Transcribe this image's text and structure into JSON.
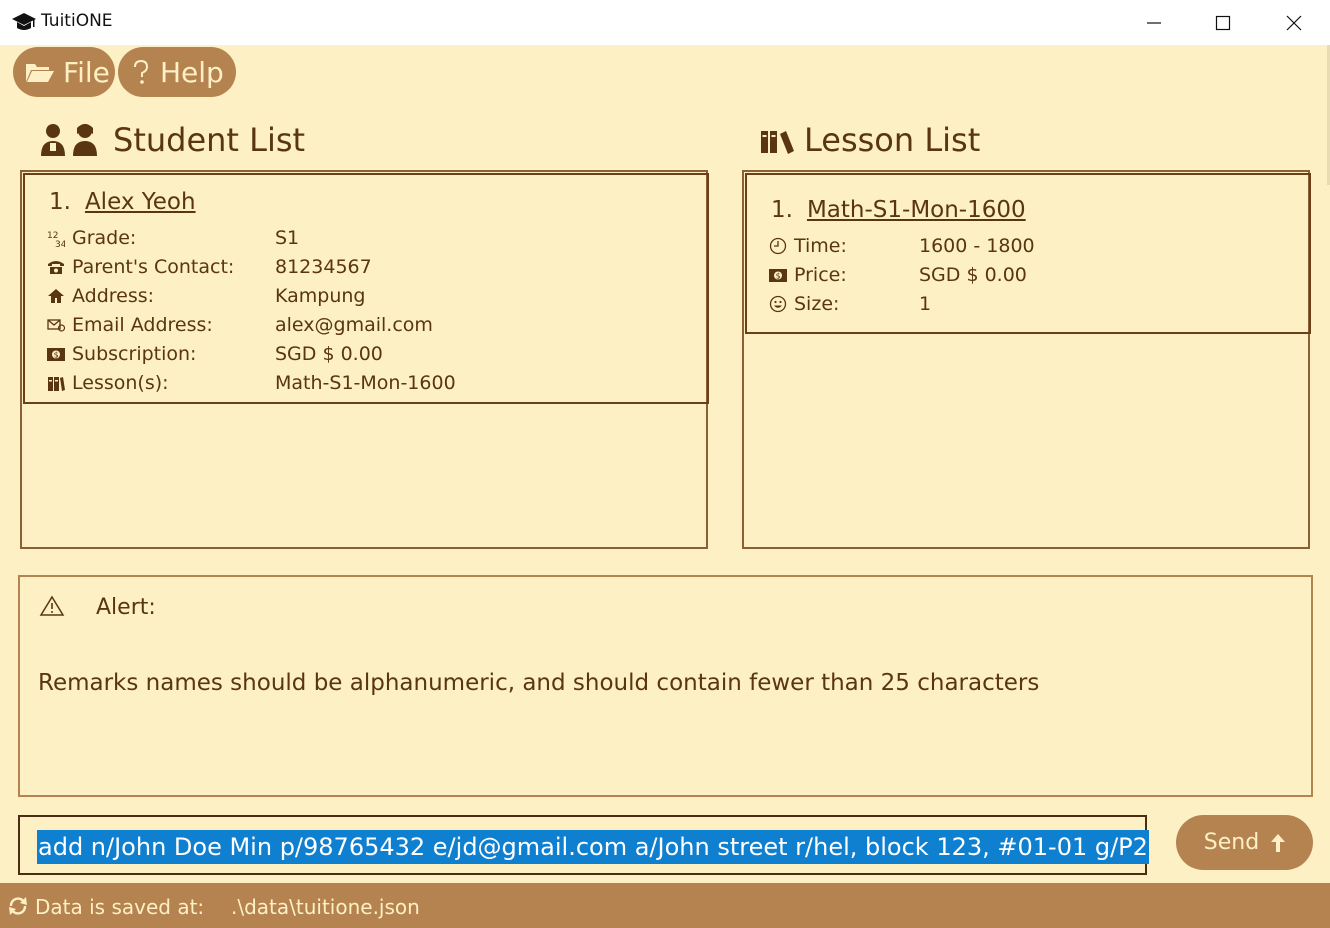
{
  "window": {
    "title": "TuitiONE"
  },
  "menu": {
    "file_label": "File",
    "help_label": "Help"
  },
  "students": {
    "heading": "Student List",
    "items": [
      {
        "index": "1.",
        "name": "Alex Yeoh",
        "fields": [
          {
            "icon": "grade-icon",
            "label": "Grade:",
            "value": "S1"
          },
          {
            "icon": "phone-icon",
            "label": "Parent's Contact:",
            "value": "81234567"
          },
          {
            "icon": "home-icon",
            "label": "Address:",
            "value": "Kampung"
          },
          {
            "icon": "email-icon",
            "label": "Email Address:",
            "value": "alex@gmail.com"
          },
          {
            "icon": "money-icon",
            "label": "Subscription:",
            "value": "SGD $ 0.00"
          },
          {
            "icon": "lessons-icon",
            "label": "Lesson(s):",
            "value": "Math-S1-Mon-1600"
          }
        ]
      }
    ]
  },
  "lessons": {
    "heading": "Lesson List",
    "items": [
      {
        "index": "1.",
        "name": "Math-S1-Mon-1600",
        "fields": [
          {
            "icon": "clock-icon",
            "label": "Time:",
            "value": "1600 - 1800"
          },
          {
            "icon": "money-icon",
            "label": "Price:",
            "value": "SGD $ 0.00"
          },
          {
            "icon": "smiley-icon",
            "label": "Size:",
            "value": "1"
          }
        ]
      }
    ]
  },
  "alert": {
    "title": "Alert:",
    "message": "Remarks names should be alphanumeric, and should contain fewer than 25 characters"
  },
  "command": {
    "value": "add n/John Doe Min p/98765432 e/jd@gmail.com a/John street r/hel, block 123, #01-01 g/P2",
    "send_label": "Send"
  },
  "status": {
    "label": "Data is saved at:",
    "path": ".\\data\\tuitione.json"
  },
  "colors": {
    "background": "#fdf0c4",
    "accent": "#b5834f",
    "text": "#5a3513",
    "selection": "#0f7fd0"
  }
}
